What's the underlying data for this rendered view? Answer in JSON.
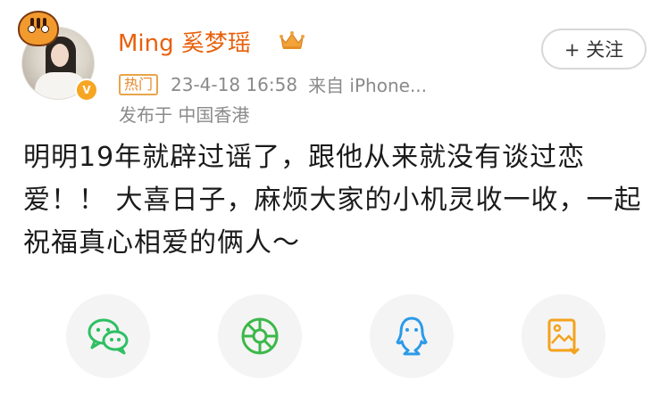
{
  "post": {
    "username": "Ming 奚梦瑶",
    "follow_label": "+ 关注",
    "hot_tag": "热门",
    "datetime": "23-4-18 16:58",
    "source": "来自 iPhone...",
    "location": "发布于 中国香港",
    "text": "明明19年就辟过谣了，跟他从来就没有谈过恋爱！！ 大喜日子，麻烦大家的小机灵收一收，一起祝福真心相爱的俩人～"
  },
  "avatar": {
    "badge": "V"
  },
  "share": [
    {
      "icon": "wechat-icon",
      "color": "#2fbf63"
    },
    {
      "icon": "moments-icon",
      "color": "#3cb84a"
    },
    {
      "icon": "qq-icon",
      "color": "#2a9ae8"
    },
    {
      "icon": "save-image-icon",
      "color": "#f3a21c"
    }
  ],
  "colors": {
    "username": "#e8600b",
    "meta": "#8a8a8a",
    "hot_border": "#e8a54a"
  }
}
